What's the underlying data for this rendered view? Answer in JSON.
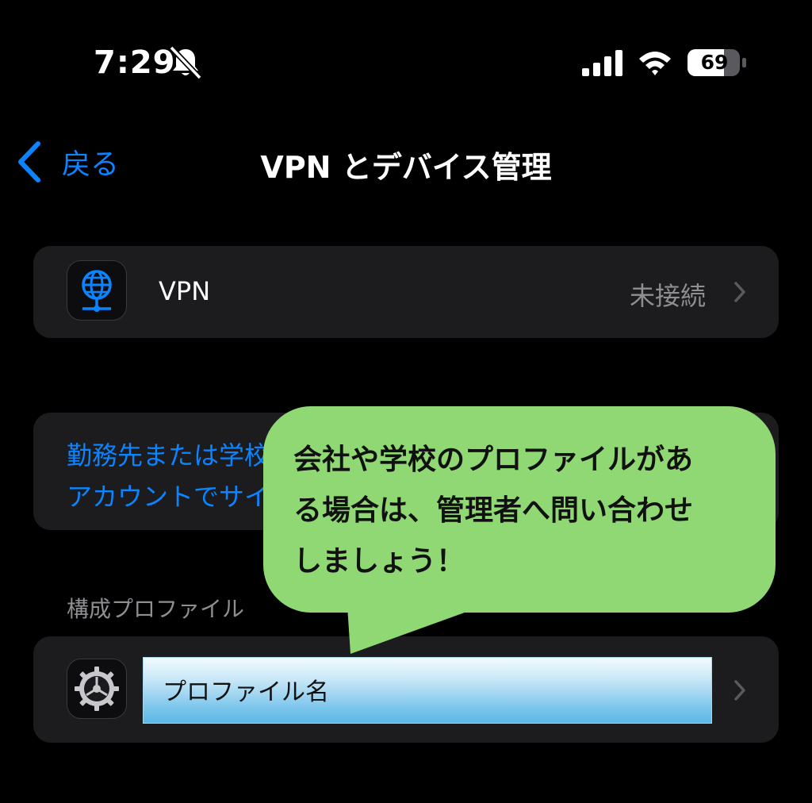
{
  "status_bar": {
    "time": "7:29",
    "battery_percent": "69",
    "icons": [
      "bell-slash-icon",
      "cellular-signal-icon",
      "wifi-icon",
      "battery-icon"
    ]
  },
  "nav": {
    "back_label": "戻る",
    "title": "VPN とデバイス管理"
  },
  "vpn_row": {
    "icon": "globe-network-icon",
    "label": "VPN",
    "status": "未接続"
  },
  "management_row": {
    "text": "勤務先または学校のアカウントでサインインしてください..."
  },
  "profiles_section": {
    "header": "構成プロファイル",
    "items": [
      {
        "icon": "gear-icon",
        "name": "プロファイル名"
      }
    ]
  },
  "callout": {
    "line1": "会社や学校のプロファイルがあ",
    "line2": "る場合は、管理者へ問い合わせ",
    "line3": "しましょう！"
  },
  "colors": {
    "background": "#000000",
    "cell": "#1c1c1e",
    "accent": "#0a84ff",
    "secondary_text": "#8e8e93",
    "callout": "#8fd873"
  }
}
